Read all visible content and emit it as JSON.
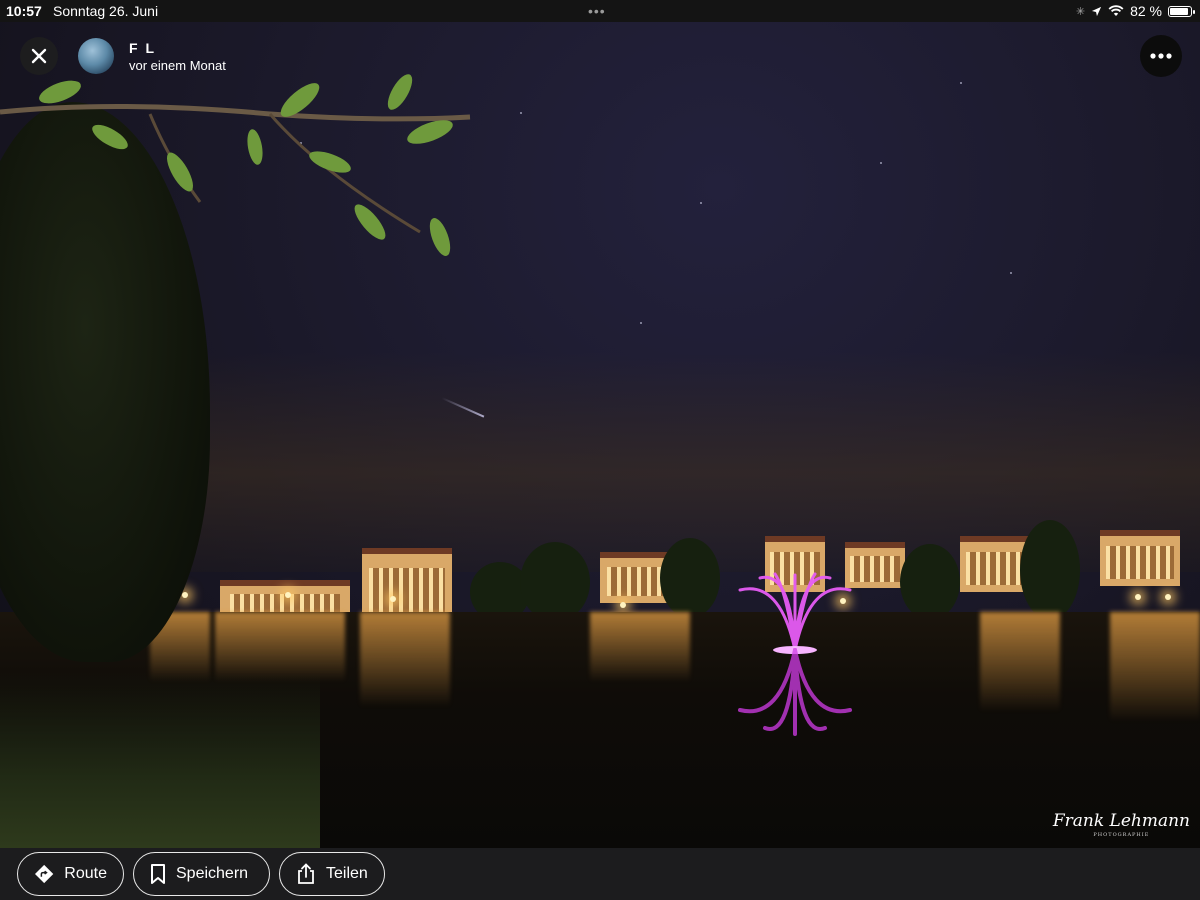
{
  "status_bar": {
    "time": "10:57",
    "date": "Sonntag 26. Juni",
    "battery": "82 %",
    "battery_level": 0.82
  },
  "header": {
    "user_name": "F L",
    "posted": "vor einem Monat",
    "close_icon": "close-icon",
    "more_icon": "more-icon"
  },
  "photo": {
    "watermark": "Frank Lehmann",
    "watermark_sub": "PHOTOGRAPHIE"
  },
  "actions": [
    {
      "label": "Route",
      "icon": "route-icon"
    },
    {
      "label": "Speichern",
      "icon": "bookmark-icon"
    },
    {
      "label": "Teilen",
      "icon": "share-icon"
    }
  ],
  "colors": {
    "fountain": "#e03cf0",
    "lights": "#f0b860",
    "bar": "#1c1c1e"
  }
}
